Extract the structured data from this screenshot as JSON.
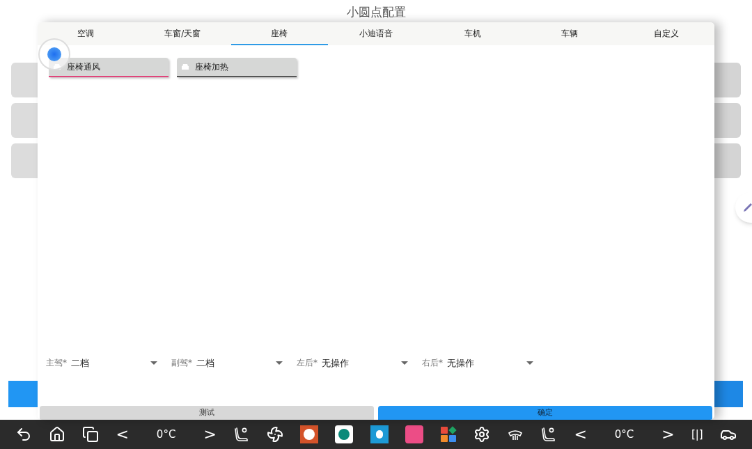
{
  "page_title": "小圆点配置",
  "tabs": [
    {
      "label": "空调",
      "selected": false
    },
    {
      "label": "车窗/天窗",
      "selected": false
    },
    {
      "label": "座椅",
      "selected": true
    },
    {
      "label": "小迪语音",
      "selected": false
    },
    {
      "label": "车机",
      "selected": false
    },
    {
      "label": "车辆",
      "selected": false
    },
    {
      "label": "自定义",
      "selected": false
    }
  ],
  "chips": [
    {
      "label": "座椅通风",
      "selected": true
    },
    {
      "label": "座椅加热",
      "selected": false
    }
  ],
  "selects": [
    {
      "label": "主驾*",
      "value": "二档"
    },
    {
      "label": "副驾*",
      "value": "二档"
    },
    {
      "label": "左后*",
      "value": "无操作"
    },
    {
      "label": "右后*",
      "value": "无操作"
    }
  ],
  "buttons": [
    {
      "label": "测试",
      "kind": "secondary"
    },
    {
      "label": "确定",
      "kind": "primary"
    }
  ],
  "taskbar": {
    "left_climate": [
      "<",
      "0°C",
      ">"
    ],
    "right_climate": [
      "<",
      "0°C",
      ">"
    ],
    "split_label": "[|]"
  }
}
